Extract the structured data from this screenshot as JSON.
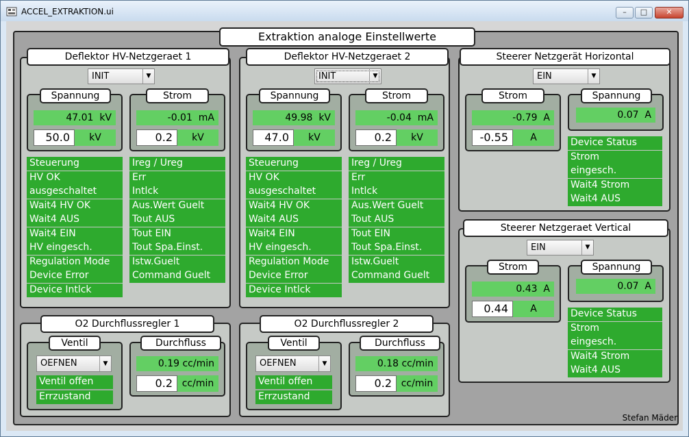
{
  "window": {
    "title": "ACCEL_EXTRAKTION.ui",
    "minimize": "–",
    "maximize": "□",
    "close": "✕"
  },
  "main_title": "Extraktion analoge Einstellwerte",
  "hv1": {
    "title": "Deflektor HV-Netzgeraet 1",
    "combo": "INIT",
    "spannung": {
      "title": "Spannung",
      "readback": "47.01",
      "readback_unit": "kV",
      "setpoint": "50.0",
      "set_unit": "kV"
    },
    "strom": {
      "title": "Strom",
      "readback": "-0.01",
      "readback_unit": "mA",
      "setpoint": "0.2",
      "set_unit": "kV"
    },
    "status_left": [
      "Steuerung",
      "HV OK",
      "ausgeschaltet",
      "Wait4 HV OK",
      "Wait4 AUS",
      "Wait4 EIN",
      "HV eingesch.",
      "Regulation Mode",
      "Device Error",
      "Device Intlck"
    ],
    "status_right": [
      "Ireg / Ureg",
      "Err",
      "Intlck",
      "Aus.Wert Guelt",
      "Tout AUS",
      "Tout EIN",
      "Tout Spa.Einst.",
      "Istw.Guelt",
      "Command  Guelt"
    ]
  },
  "hv2": {
    "title": "Deflektor HV-Netzgeraet 2",
    "combo": "INIT",
    "spannung": {
      "title": "Spannung",
      "readback": "49.98",
      "readback_unit": "kV",
      "setpoint": "47.0",
      "set_unit": "kV"
    },
    "strom": {
      "title": "Strom",
      "readback": "-0.04",
      "readback_unit": "mA",
      "setpoint": "0.2",
      "set_unit": "kV"
    },
    "status_left": [
      "Steuerung",
      "HV OK",
      "ausgeschaltet",
      "Wait4 HV OK",
      "Wait4 AUS",
      "Wait4 EIN",
      "HV eingesch.",
      "Regulation Mode",
      "Device Error",
      "Device Intlck"
    ],
    "status_right": [
      "Ireg / Ureg",
      "Err",
      "Intlck",
      "Aus.Wert Guelt",
      "Tout AUS",
      "Tout EIN",
      "Tout Spa.Einst.",
      "Istw.Guelt",
      "Command  Guelt"
    ]
  },
  "steerer_h": {
    "title": "Steerer Netzgerät Horizontal",
    "combo": "EIN",
    "strom": {
      "title": "Strom",
      "readback": "-0.79",
      "readback_unit": "A",
      "setpoint": "-0.55",
      "set_unit": "A"
    },
    "spannung": {
      "title": "Spannung",
      "readback": "0.07",
      "readback_unit": "A"
    },
    "status": [
      "Device Status",
      "Strom",
      "eingesch.",
      "Wait4 Strom",
      "Wait4 AUS"
    ]
  },
  "steerer_v": {
    "title": "Steerer Netzgeraet Vertical",
    "combo": "EIN",
    "strom": {
      "title": "Strom",
      "readback": "0.43",
      "readback_unit": "A",
      "setpoint": "0.44",
      "set_unit": "A"
    },
    "spannung": {
      "title": "Spannung",
      "readback": "0.07",
      "readback_unit": "A"
    },
    "status": [
      "Device Status",
      "Strom",
      "eingesch.",
      "Wait4 Strom",
      "Wait4 AUS"
    ]
  },
  "o2_1": {
    "title": "O2 Durchflussregler 1",
    "ventil": {
      "title": "Ventil",
      "combo": "OEFNEN",
      "status": [
        "Ventil offen",
        "Errzustand"
      ]
    },
    "durchfluss": {
      "title": "Durchfluss",
      "readback": "0.19",
      "readback_unit": "cc/min",
      "setpoint": "0.2",
      "set_unit": "cc/min"
    }
  },
  "o2_2": {
    "title": "O2 Durchflussregler 2",
    "ventil": {
      "title": "Ventil",
      "combo": "OEFNEN",
      "status": [
        "Ventil offen",
        "Errzustand"
      ]
    },
    "durchfluss": {
      "title": "Durchfluss",
      "readback": "0.18",
      "readback_unit": "cc/min",
      "setpoint": "0.2",
      "set_unit": "cc/min"
    }
  },
  "author": "Stefan Mäder",
  "colors": {
    "frame_bg": "#a3a3a3",
    "group_bg": "#c6cac6",
    "subgroup_bg": "#a2aea2",
    "readback_green": "#63cf63",
    "status_green": "#2eaa2e"
  }
}
